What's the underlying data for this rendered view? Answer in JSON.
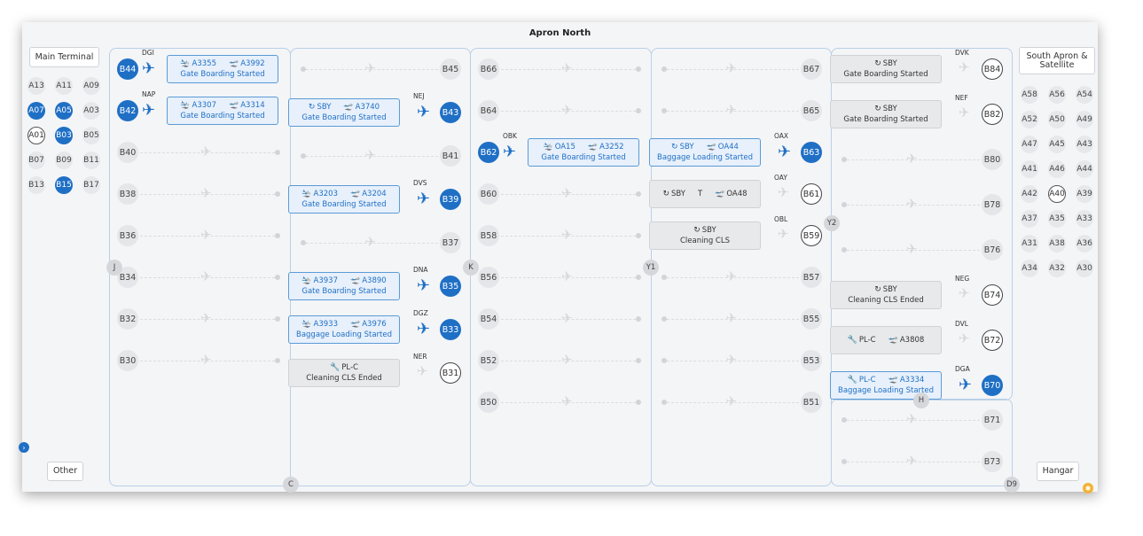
{
  "title": "Apron North",
  "buttons": {
    "main_terminal": "Main Terminal",
    "south_apron": "South Apron & Satellite",
    "other": "Other",
    "hangar": "Hangar"
  },
  "left_stands": [
    {
      "label": "A13",
      "state": "plain"
    },
    {
      "label": "A11",
      "state": "plain"
    },
    {
      "label": "A09",
      "state": "plain"
    },
    {
      "label": "A07",
      "state": "occ"
    },
    {
      "label": "A05",
      "state": "occ"
    },
    {
      "label": "A03",
      "state": "plain"
    },
    {
      "label": "A01",
      "state": "ring"
    },
    {
      "label": "B03",
      "state": "occ"
    },
    {
      "label": "B05",
      "state": "plain"
    },
    {
      "label": "B07",
      "state": "plain"
    },
    {
      "label": "B09",
      "state": "plain"
    },
    {
      "label": "B11",
      "state": "plain"
    },
    {
      "label": "B13",
      "state": "plain"
    },
    {
      "label": "B15",
      "state": "occ"
    },
    {
      "label": "B17",
      "state": "plain"
    }
  ],
  "right_stands": [
    {
      "label": "A58",
      "state": "plain"
    },
    {
      "label": "A56",
      "state": "plain"
    },
    {
      "label": "A54",
      "state": "plain"
    },
    {
      "label": "A52",
      "state": "plain"
    },
    {
      "label": "A50",
      "state": "plain"
    },
    {
      "label": "A49",
      "state": "plain"
    },
    {
      "label": "A47",
      "state": "plain"
    },
    {
      "label": "A45",
      "state": "plain"
    },
    {
      "label": "A43",
      "state": "plain"
    },
    {
      "label": "A41",
      "state": "plain"
    },
    {
      "label": "A46",
      "state": "plain"
    },
    {
      "label": "A44",
      "state": "plain"
    },
    {
      "label": "A42",
      "state": "plain"
    },
    {
      "label": "A40",
      "state": "ring"
    },
    {
      "label": "A39",
      "state": "plain"
    },
    {
      "label": "A37",
      "state": "plain"
    },
    {
      "label": "A35",
      "state": "plain"
    },
    {
      "label": "A33",
      "state": "plain"
    },
    {
      "label": "A31",
      "state": "plain"
    },
    {
      "label": "A38",
      "state": "plain"
    },
    {
      "label": "A36",
      "state": "plain"
    },
    {
      "label": "A34",
      "state": "plain"
    },
    {
      "label": "A32",
      "state": "plain"
    },
    {
      "label": "A30",
      "state": "plain"
    }
  ],
  "taxiways": [
    "J",
    "C",
    "K",
    "Y1",
    "Y2",
    "H",
    "D9"
  ],
  "columns": [
    {
      "id": "col1",
      "side": "left",
      "stands": [
        {
          "label": "B44",
          "state": "occ",
          "code": "DGI",
          "card": {
            "style": "blue",
            "arr": "A3355",
            "dep": "A3992",
            "status": "Gate Boarding Started"
          }
        },
        {
          "label": "B42",
          "state": "occ",
          "code": "NAP",
          "card": {
            "style": "blue",
            "arr": "A3307",
            "dep": "A3314",
            "status": "Gate Boarding Started"
          }
        },
        {
          "label": "B40",
          "state": "plain"
        },
        {
          "label": "B38",
          "state": "plain"
        },
        {
          "label": "B36",
          "state": "plain"
        },
        {
          "label": "B34",
          "state": "plain"
        },
        {
          "label": "B32",
          "state": "plain"
        },
        {
          "label": "B30",
          "state": "plain"
        }
      ]
    },
    {
      "id": "col2",
      "side": "right",
      "stands": [
        {
          "label": "B45",
          "state": "plain"
        },
        {
          "label": "B43",
          "state": "occ",
          "code": "NEJ",
          "card": {
            "style": "blue",
            "arr": "SBY",
            "arr_icon": "standby-icon",
            "dep": "A3740",
            "status": "Gate Boarding Started"
          }
        },
        {
          "label": "B41",
          "state": "plain"
        },
        {
          "label": "B39",
          "state": "occ",
          "code": "DVS",
          "card": {
            "style": "blue",
            "arr": "A3203",
            "dep": "A3204",
            "status": "Gate Boarding Started"
          }
        },
        {
          "label": "B37",
          "state": "plain"
        },
        {
          "label": "B35",
          "state": "occ",
          "code": "DNA",
          "card": {
            "style": "blue",
            "arr": "A3937",
            "dep": "A3890",
            "status": "Gate Boarding Started"
          }
        },
        {
          "label": "B33",
          "state": "occ",
          "code": "DGZ",
          "card": {
            "style": "blue",
            "arr": "A3933",
            "dep": "A3976",
            "status": "Baggage Loading Started"
          }
        },
        {
          "label": "B31",
          "state": "ring",
          "code": "NER",
          "card": {
            "style": "gray",
            "single": "PL-C",
            "single_icon": "wrench-icon",
            "status": "Cleaning CLS Ended"
          }
        }
      ]
    },
    {
      "id": "col3",
      "side": "left",
      "stands": [
        {
          "label": "B66",
          "state": "plain"
        },
        {
          "label": "B64",
          "state": "plain"
        },
        {
          "label": "B62",
          "state": "occ",
          "code": "OBK",
          "card": {
            "style": "blue",
            "arr": "OA15",
            "dep": "A3252",
            "status": "Gate Boarding Started"
          }
        },
        {
          "label": "B60",
          "state": "plain"
        },
        {
          "label": "B58",
          "state": "plain"
        },
        {
          "label": "B56",
          "state": "plain"
        },
        {
          "label": "B54",
          "state": "plain"
        },
        {
          "label": "B52",
          "state": "plain"
        },
        {
          "label": "B50",
          "state": "plain"
        }
      ]
    },
    {
      "id": "col4",
      "side": "right",
      "stands": [
        {
          "label": "B67",
          "state": "plain"
        },
        {
          "label": "B65",
          "state": "plain"
        },
        {
          "label": "B63",
          "state": "occ",
          "code": "OAX",
          "card": {
            "style": "blue",
            "arr": "SBY",
            "arr_icon": "standby-icon",
            "dep": "OA44",
            "status": "Baggage Loading Started"
          }
        },
        {
          "label": "B61",
          "state": "ring",
          "code": "OAY",
          "card": {
            "style": "gray",
            "row": [
              "SBY",
              "T",
              "OA48"
            ]
          }
        },
        {
          "label": "B59",
          "state": "ring",
          "code": "OBL",
          "card": {
            "style": "gray",
            "single": "SBY",
            "single_icon": "standby-icon",
            "status": "Cleaning CLS"
          }
        },
        {
          "label": "B57",
          "state": "plain"
        },
        {
          "label": "B55",
          "state": "plain"
        },
        {
          "label": "B53",
          "state": "plain"
        },
        {
          "label": "B51",
          "state": "plain"
        }
      ]
    },
    {
      "id": "col5",
      "side": "right",
      "stands": [
        {
          "label": "B84",
          "state": "ring",
          "code": "DVK",
          "card": {
            "style": "gray",
            "single": "SBY",
            "single_icon": "standby-icon",
            "status": "Gate Boarding Started"
          }
        },
        {
          "label": "B82",
          "state": "ring",
          "code": "NEF",
          "card": {
            "style": "gray",
            "single": "SBY",
            "single_icon": "standby-icon",
            "status": "Gate Boarding Started"
          }
        },
        {
          "label": "B80",
          "state": "plain"
        },
        {
          "label": "B78",
          "state": "plain"
        },
        {
          "label": "B76",
          "state": "plain"
        },
        {
          "label": "B74",
          "state": "ring",
          "code": "NEG",
          "card": {
            "style": "gray",
            "single": "SBY",
            "single_icon": "standby-icon",
            "status": "Cleaning CLS Ended"
          }
        },
        {
          "label": "B72",
          "state": "ring",
          "code": "DVL",
          "card": {
            "style": "gray",
            "pair": [
              "PL-C",
              "A3808"
            ]
          }
        },
        {
          "label": "B70",
          "state": "occ",
          "code": "DGA",
          "card": {
            "style": "blue",
            "arr": "PL-C",
            "arr_icon": "wrench-icon",
            "dep": "A3334",
            "status": "Baggage Loading Started"
          }
        },
        {
          "label": "B71",
          "state": "plain"
        },
        {
          "label": "B73",
          "state": "plain"
        }
      ]
    }
  ]
}
